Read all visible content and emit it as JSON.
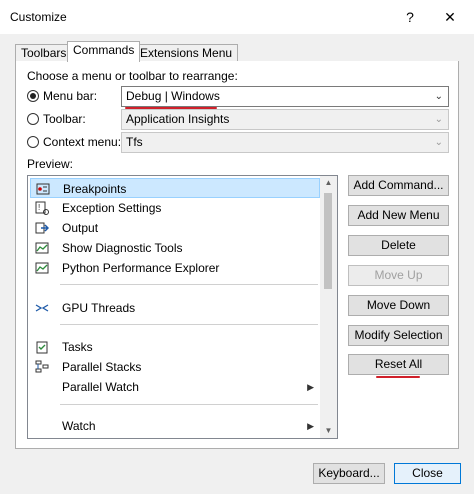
{
  "window": {
    "title": "Customize",
    "help_glyph": "?",
    "close_glyph": "✕"
  },
  "tabs": [
    {
      "label": "Toolbars"
    },
    {
      "label": "Commands"
    },
    {
      "label": "Extensions Menu"
    }
  ],
  "prompt": "Choose a menu or toolbar to rearrange:",
  "options": {
    "menu_bar": {
      "label": "Menu bar:",
      "value": "Debug | Windows"
    },
    "toolbar": {
      "label": "Toolbar:",
      "value": "Application Insights"
    },
    "context_menu": {
      "label": "Context menu:",
      "value": "Tfs"
    }
  },
  "preview_label": "Preview:",
  "preview_items": [
    {
      "label": "Breakpoints"
    },
    {
      "label": "Exception Settings"
    },
    {
      "label": "Output"
    },
    {
      "label": "Show Diagnostic Tools"
    },
    {
      "label": "Python Performance Explorer"
    },
    {
      "label": "GPU Threads"
    },
    {
      "label": "Tasks"
    },
    {
      "label": "Parallel Stacks"
    },
    {
      "label": "Parallel Watch"
    },
    {
      "label": "Watch"
    }
  ],
  "buttons": {
    "add_command": "Add Command...",
    "add_new_menu": "Add New Menu",
    "delete": "Delete",
    "move_up": "Move Up",
    "move_down": "Move Down",
    "modify_selection": "Modify Selection",
    "reset_all": "Reset All"
  },
  "footer": {
    "keyboard": "Keyboard...",
    "close": "Close"
  },
  "colors": {
    "selection": "#cce8ff",
    "accent": "#0078d7",
    "annotation": "#d0202a"
  }
}
